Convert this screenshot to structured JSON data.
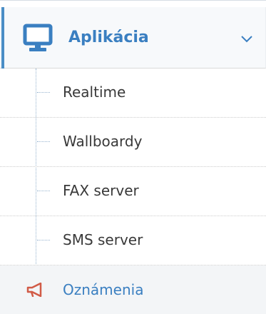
{
  "menu": {
    "title": "Aplikácia",
    "icon": "desktop-icon",
    "expand_icon": "chevron-down-icon",
    "expanded": true,
    "accent_color": "#3a7fc1",
    "items": [
      {
        "label": "Realtime"
      },
      {
        "label": "Wallboardy"
      },
      {
        "label": "FAX server"
      },
      {
        "label": "SMS server"
      }
    ]
  },
  "next_item": {
    "label": "Oznámenia",
    "icon": "bullhorn-icon",
    "icon_color": "#d15b47"
  }
}
